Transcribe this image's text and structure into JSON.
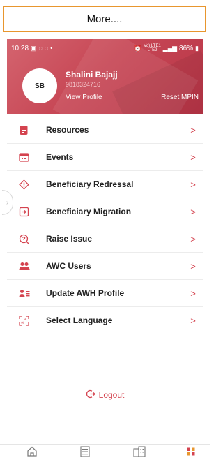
{
  "banner": {
    "label": "More...."
  },
  "status_bar": {
    "time": "10:28",
    "battery": "86%",
    "network": "Vo) LTE1",
    "network_sub": "LTE2"
  },
  "profile": {
    "initials": "SB",
    "name": "Shalini Bajajj",
    "phone": "9818324716",
    "view_profile": "View Profile",
    "reset_mpin": "Reset MPIN"
  },
  "menu": [
    {
      "label": "Resources",
      "icon": "document-icon"
    },
    {
      "label": "Events",
      "icon": "calendar-icon"
    },
    {
      "label": "Beneficiary Redressal",
      "icon": "diamond-alert-icon"
    },
    {
      "label": "Beneficiary Migration",
      "icon": "migration-icon"
    },
    {
      "label": "Raise Issue",
      "icon": "raise-issue-icon"
    },
    {
      "label": "AWC Users",
      "icon": "users-icon"
    },
    {
      "label": "Update AWH Profile",
      "icon": "profile-list-icon"
    },
    {
      "label": "Select Language",
      "icon": "language-icon"
    }
  ],
  "logout": {
    "label": "Logout"
  },
  "colors": {
    "accent": "#d4434f",
    "header": "#c74755",
    "banner_border": "#e8962e"
  },
  "bottom_nav": [
    "home-icon",
    "list-icon",
    "building-icon",
    "grid-icon"
  ]
}
